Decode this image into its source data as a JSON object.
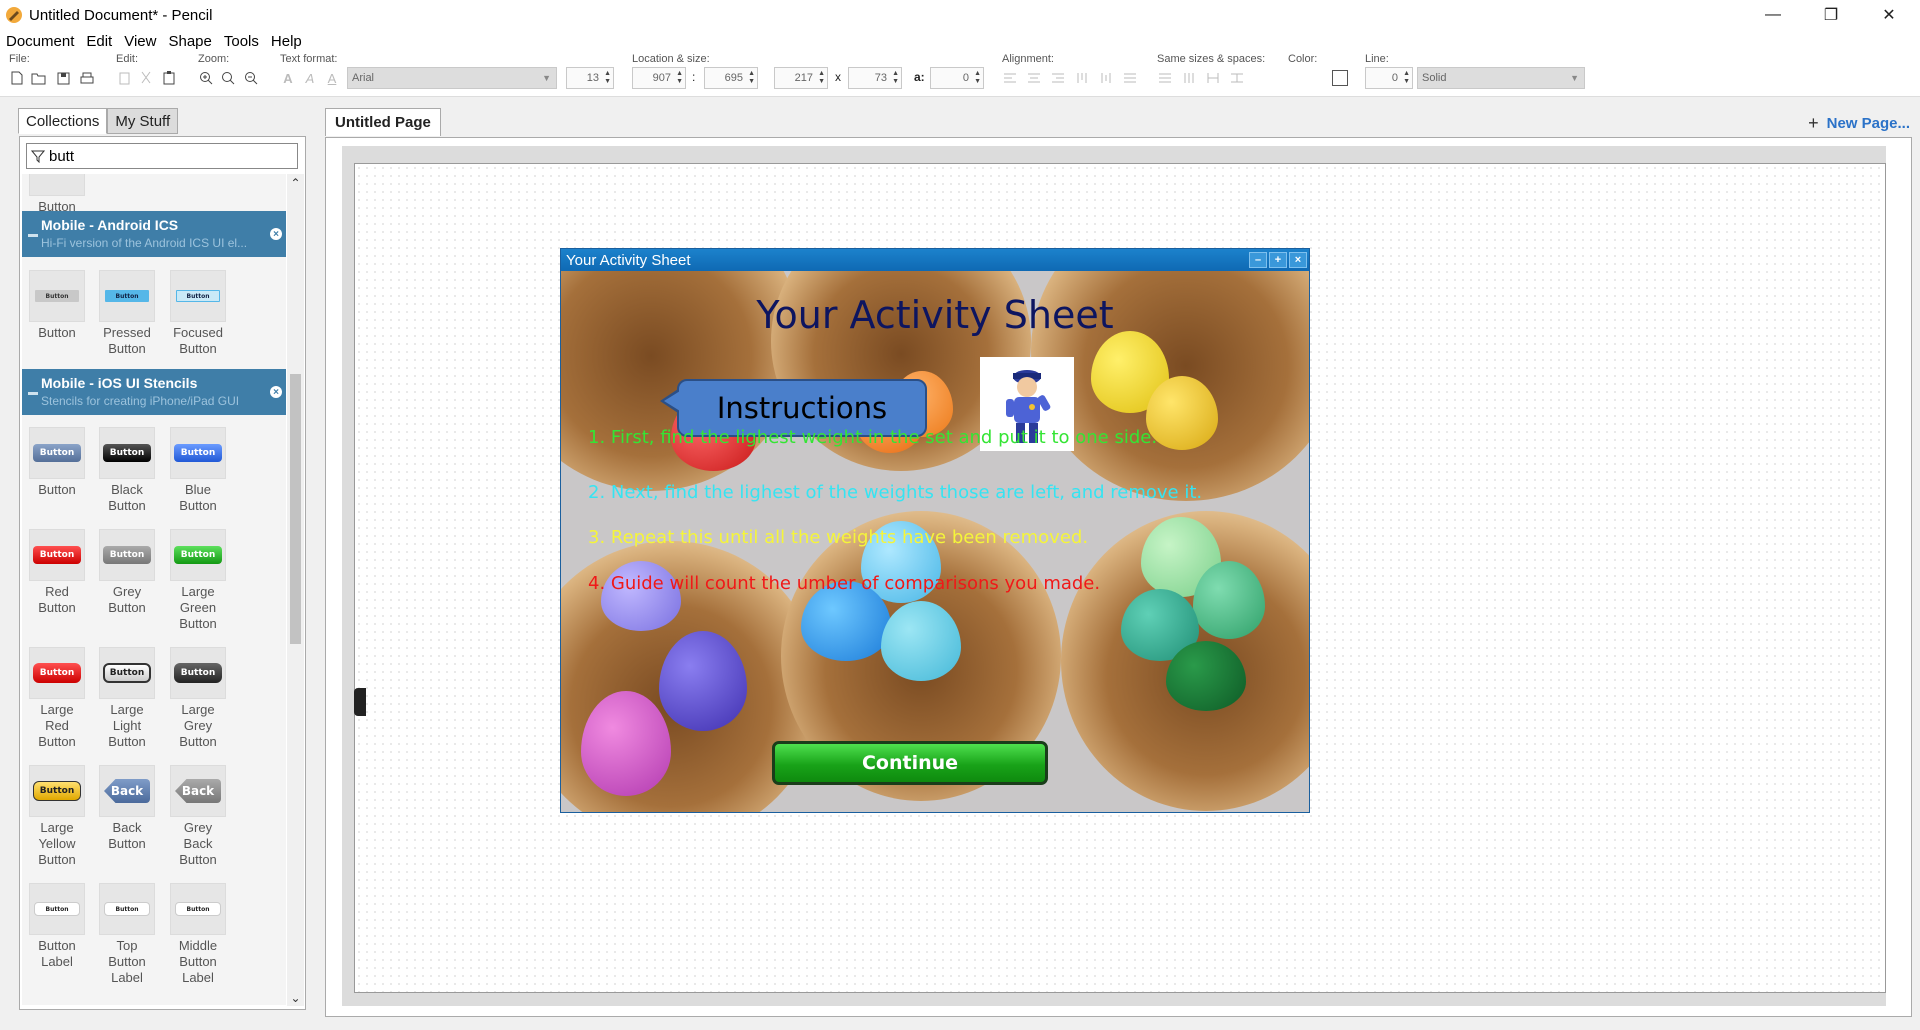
{
  "window": {
    "title": "Untitled Document* - Pencil",
    "minimize": "—",
    "restore": "❐",
    "close": "✕"
  },
  "menu": [
    "Document",
    "Edit",
    "View",
    "Shape",
    "Tools",
    "Help"
  ],
  "toolbar": {
    "file_label": "File:",
    "edit_label": "Edit:",
    "zoom_label": "Zoom:",
    "text_format_label": "Text format:",
    "font_name": "Arial",
    "font_size": "13",
    "location_label": "Location & size:",
    "x": "907",
    "y": "695",
    "w": "217",
    "h": "73",
    "angle": "0",
    "colon": ":",
    "times": "x",
    "angle_label": "a:",
    "alignment_label": "Alignment:",
    "same_sizes_label": "Same sizes & spaces:",
    "color_label": "Color:",
    "line_label": "Line:",
    "line_width": "0",
    "line_style": "Solid"
  },
  "sidebar": {
    "tabs": [
      "Collections",
      "My Stuff"
    ],
    "search_value": "butt",
    "top_item": "Button",
    "categories": [
      {
        "name": "Mobile - Android ICS",
        "description": "Hi-Fi version of the Android ICS UI el...",
        "items": [
          {
            "label": [
              "Button"
            ],
            "preview": "Button"
          },
          {
            "label": [
              "Pressed",
              "Button"
            ],
            "preview": "Button"
          },
          {
            "label": [
              "Focused",
              "Button"
            ],
            "preview": "Button"
          }
        ]
      },
      {
        "name": "Mobile - iOS UI Stencils",
        "description": "Stencils for creating iPhone/iPad GUI",
        "items": [
          {
            "label": [
              "Button"
            ],
            "preview": "Button"
          },
          {
            "label": [
              "Black",
              "Button"
            ],
            "preview": "Button"
          },
          {
            "label": [
              "Blue",
              "Button"
            ],
            "preview": "Button"
          },
          {
            "label": [
              "Red",
              "Button"
            ],
            "preview": "Button"
          },
          {
            "label": [
              "Grey",
              "Button"
            ],
            "preview": "Button"
          },
          {
            "label": [
              "Large",
              "Green",
              "Button"
            ],
            "preview": "Button"
          },
          {
            "label": [
              "Large",
              "Red",
              "Button"
            ],
            "preview": "Button"
          },
          {
            "label": [
              "Large",
              "Light",
              "Button"
            ],
            "preview": "Button"
          },
          {
            "label": [
              "Large",
              "Grey",
              "Button"
            ],
            "preview": "Button"
          },
          {
            "label": [
              "Large",
              "Yellow",
              "Button"
            ],
            "preview": "Button"
          },
          {
            "label": [
              "Back",
              "Button"
            ],
            "preview": "Back"
          },
          {
            "label": [
              "Grey",
              "Back",
              "Button"
            ],
            "preview": "Back"
          },
          {
            "label": [
              "Button",
              "Label"
            ],
            "preview": "Button"
          },
          {
            "label": [
              "Top",
              "Button",
              "Label"
            ],
            "preview": "Button"
          },
          {
            "label": [
              "Middle",
              "Button",
              "Label"
            ],
            "preview": "Button"
          }
        ]
      }
    ]
  },
  "page": {
    "tab": "Untitled Page",
    "new_page": "New Page..."
  },
  "activity": {
    "window_title": "Your Activity Sheet",
    "heading": "Your Activity Sheet",
    "callout": "Instructions",
    "instructions": [
      {
        "text": "1. First, find the lighest weight in the set and put it to one side.",
        "color": "#34e534"
      },
      {
        "text": "2. Next, find the lighest of the weights those are left, and remove it.",
        "color": "#35e4f2"
      },
      {
        "text": "3. Repeat this until all the weights have been removed.",
        "color": "#f5f53a"
      },
      {
        "text": "4. Guide will count the  umber of comparisons you made.",
        "color": "#f01818"
      }
    ],
    "continue": "Continue"
  },
  "colors": {
    "category_header": "#3f7ea8",
    "link": "#2b72c8",
    "window_bar": "#1473bf",
    "continue_green": "#19a319"
  }
}
